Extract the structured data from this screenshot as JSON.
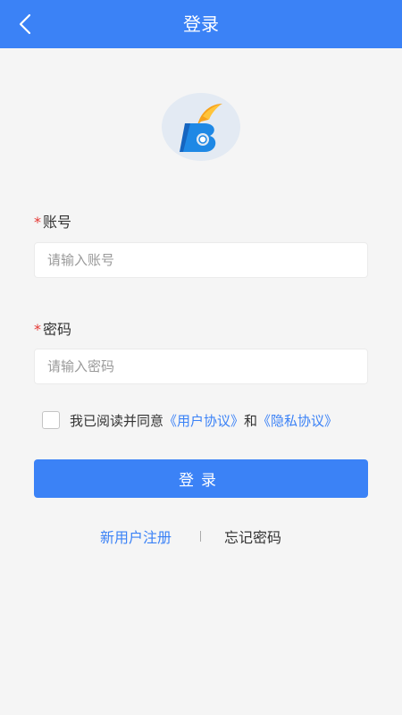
{
  "header": {
    "title": "登录",
    "back_icon": "chevron-left-icon",
    "background": "#3b82f6"
  },
  "logo": {
    "icon": "app-logo"
  },
  "form": {
    "account": {
      "required_mark": "*",
      "label": "账号",
      "value": "",
      "placeholder": "请输入账号"
    },
    "password": {
      "required_mark": "*",
      "label": "密码",
      "value": "",
      "placeholder": "请输入密码"
    },
    "agreement": {
      "checked": false,
      "prefix": "我已阅读并同意",
      "user_agreement": "《用户协议》",
      "conjunction": "和",
      "privacy_policy": "《隐私协议》"
    },
    "submit_label": "登录"
  },
  "footer": {
    "register_label": "新用户注册",
    "forgot_label": "忘记密码"
  },
  "colors": {
    "accent": "#3b82f6",
    "required": "#e53935",
    "background": "#f5f5f5"
  }
}
